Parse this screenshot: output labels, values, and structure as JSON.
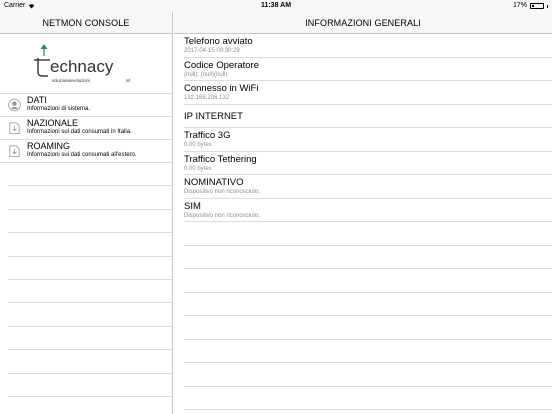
{
  "status_bar": {
    "carrier": "Carrier",
    "time": "11:38 AM",
    "battery_label": "17%",
    "battery_level": 0.17
  },
  "master": {
    "title": "NETMON CONSOLE",
    "logo": {
      "word": "echnacy",
      "tagline": "soluzioni&evoluzioni",
      "suffix": "srl"
    },
    "items": [
      {
        "title": "DATI",
        "subtitle": "Informazioni di sistema.",
        "icon": "user-icon"
      },
      {
        "title": "NAZIONALE",
        "subtitle": "Informazioni sui dati consumati in Italia.",
        "icon": "document-icon"
      },
      {
        "title": "ROAMING",
        "subtitle": "Informazioni sui dati consumati all'estero.",
        "icon": "document-icon"
      }
    ]
  },
  "detail": {
    "title": "INFORMAZIONI GENERALI",
    "rows": [
      {
        "title": "Telefono avviato",
        "subtitle": "2017-04-15 09:30:29"
      },
      {
        "title": "Codice Operatore",
        "subtitle": "(null): (null)(null)"
      },
      {
        "title": "Connesso in WiFi",
        "subtitle": "192.168.206.132"
      },
      {
        "title": "IP INTERNET",
        "subtitle": ""
      },
      {
        "title": "Traffico 3G",
        "subtitle": "0.00 bytes"
      },
      {
        "title": "Traffico Tethering",
        "subtitle": "0.00 bytes"
      },
      {
        "title": "NOMINATIVO",
        "subtitle": "Dispositivo non riconosciuto."
      },
      {
        "title": "SIM",
        "subtitle": "Dispositivo non riconosciuto."
      }
    ]
  }
}
